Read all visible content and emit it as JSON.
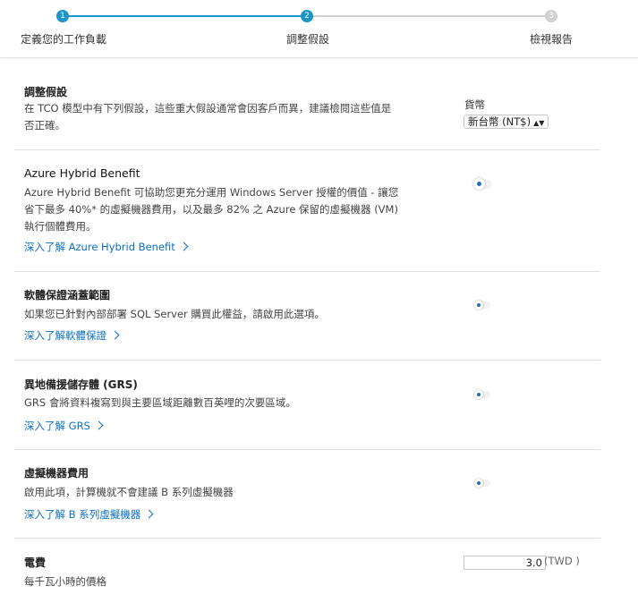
{
  "stepper": {
    "steps": [
      {
        "number": "1",
        "label": "定義您的工作負載"
      },
      {
        "number": "2",
        "label": "調整假設"
      },
      {
        "number": "3",
        "label": "檢視報告"
      }
    ],
    "colors": {
      "active": "#1b96c7",
      "inactive": "#d0d0d0"
    }
  },
  "assumptions": {
    "title": "調整假設",
    "description": "在 TCO 模型中有下列假設，這些重大假設通常會因客戶而異，建議檢閱這些值是否正確。",
    "currency_label": "貨幣",
    "currency_value": "新台幣 (NT$)"
  },
  "sections": [
    {
      "title": "Azure Hybrid Benefit",
      "description": "Azure Hybrid Benefit 可協助您更充分運用 Windows Server 授權的價值 - 讓您省下最多 40%* 的虛擬機器費用，以及最多 82% 之 Azure 保留的虛擬機器 (VM) 執行個體費用。",
      "link": "深入了解 Azure Hybrid Benefit"
    },
    {
      "title": "軟體保證涵蓋範圍",
      "description": "如果您已針對內部部署 SQL Server 購買此權益，請啟用此選項。",
      "link": "深入了解軟體保證"
    },
    {
      "title": "異地備援儲存體 (GRS)",
      "description": "GRS 會將資料複寫到與主要區域距離數百英哩的次要區域。",
      "link": "深入了解 GRS"
    },
    {
      "title": "虛擬機器費用",
      "description": "啟用此項，計算機就不會建議 B 系列虛擬機器",
      "link": "深入了解 B 系列虛擬機器"
    }
  ],
  "electricity": {
    "title": "電費",
    "description": "每千瓦小時的價格",
    "value": "3.0",
    "unit": "(TWD )"
  }
}
